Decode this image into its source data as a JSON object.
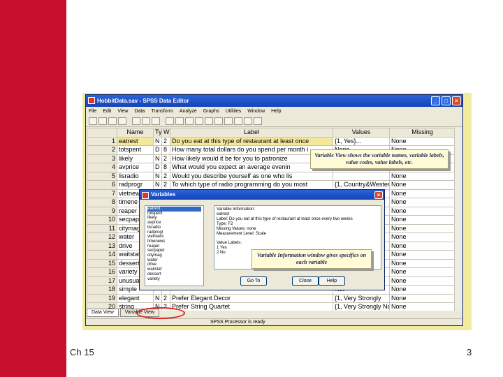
{
  "slide": {
    "footer_left": "Ch 15",
    "page_number": "3",
    "accent_color": "#c8102e"
  },
  "window": {
    "title": "HobbitData.sav - SPSS Data Editor",
    "controls": [
      "_",
      "□",
      "×"
    ],
    "menu": [
      "File",
      "Edit",
      "View",
      "Data",
      "Transform",
      "Analyze",
      "Graphs",
      "Utilities",
      "Window",
      "Help"
    ],
    "columns": [
      "",
      "Name",
      "Ty",
      "W",
      "Label",
      "Values",
      "Missing"
    ],
    "rows": [
      {
        "n": "1",
        "name": "eatrest",
        "t": "N",
        "w": "2",
        "label": "Do you eat at this type of restaurant at least once",
        "values": "{1, Yes}...",
        "missing": "None"
      },
      {
        "n": "2",
        "name": "totspent",
        "t": "D",
        "w": "8",
        "label": "How many total dollars do you spend per month i",
        "values": "None",
        "missing": "None"
      },
      {
        "n": "3",
        "name": "likely",
        "t": "N",
        "w": "2",
        "label": "How likely would it be for you to patronize",
        "values": "",
        "missing": "None"
      },
      {
        "n": "4",
        "name": "avprice",
        "t": "D",
        "w": "8",
        "label": "What would you expect an average evenin",
        "values": "",
        "missing": "None"
      },
      {
        "n": "5",
        "name": "lisradio",
        "t": "N",
        "w": "2",
        "label": "Would you describe yourself as one who lis",
        "values": "",
        "missing": "None"
      },
      {
        "n": "6",
        "name": "radprogr",
        "t": "N",
        "w": "2",
        "label": "To which type of radio programming do you most",
        "values": "{1, Country&Western}...",
        "missing": "None"
      },
      {
        "n": "7",
        "name": "vietnews",
        "t": "",
        "w": "",
        "label": "",
        "values": "",
        "missing": "None"
      },
      {
        "n": "8",
        "name": "timene",
        "t": "",
        "w": "",
        "label": "",
        "values": "s}...",
        "missing": "None"
      },
      {
        "n": "9",
        "name": "reaper",
        "t": "",
        "w": "",
        "label": "",
        "values": "",
        "missing": "None"
      },
      {
        "n": "10",
        "name": "secpap",
        "t": "",
        "w": "",
        "label": "",
        "values": "",
        "missing": "None"
      },
      {
        "n": "11",
        "name": "citymag",
        "t": "",
        "w": "",
        "label": "",
        "values": "",
        "missing": "None"
      },
      {
        "n": "12",
        "name": "water",
        "t": "",
        "w": "",
        "label": "",
        "values": "Not",
        "missing": "None"
      },
      {
        "n": "13",
        "name": "drive",
        "t": "",
        "w": "",
        "label": "",
        "values": "Not",
        "missing": "None"
      },
      {
        "n": "14",
        "name": "waitstaf",
        "t": "",
        "w": "",
        "label": "",
        "values": "Not",
        "missing": "None"
      },
      {
        "n": "15",
        "name": "dessert",
        "t": "",
        "w": "",
        "label": "",
        "values": "Not",
        "missing": "None"
      },
      {
        "n": "16",
        "name": "variety",
        "t": "",
        "w": "",
        "label": "",
        "values": "Not",
        "missing": "None"
      },
      {
        "n": "17",
        "name": "unusual",
        "t": "",
        "w": "",
        "label": "",
        "values": "Not",
        "missing": "None"
      },
      {
        "n": "18",
        "name": "simple",
        "t": "",
        "w": "",
        "label": "",
        "values": "Not",
        "missing": "None"
      },
      {
        "n": "19",
        "name": "elegant",
        "t": "N",
        "w": "2",
        "label": "Prefer Elegant Decor",
        "values": "{1, Very Strongly",
        "missing": "None"
      },
      {
        "n": "20",
        "name": "string",
        "t": "N",
        "w": "2",
        "label": "Prefer String Quartet",
        "values": "{1, Very Strongly Not",
        "missing": "None"
      }
    ],
    "tabs": [
      "Data View",
      "Variable View"
    ],
    "status": "SPSS Processor is ready"
  },
  "callouts": {
    "variable_view": "Variable View shows the variable names, variable labels, value codes, value labels, etc.",
    "info_window": "Variable Information window gives specifics on each variable"
  },
  "dialog": {
    "title": "Variables",
    "variables": [
      "eatrest",
      "totspent",
      "likely",
      "avprice",
      "lisradio",
      "radprogr",
      "vietnews",
      "timenews",
      "reaper",
      "secpaper",
      "citymag",
      "water",
      "drive",
      "waitstaf",
      "dessert",
      "variety"
    ],
    "selected_index": 0,
    "info_heading": "Variable Information:",
    "info_lines": [
      "eatrest",
      "Label: Do you eat at this type of restaurant at least once every two weeks",
      "Type: F2",
      "Missing Values: none",
      "Measurement Level: Scale",
      "",
      "Value Labels:",
      "1 Yes",
      "2 No"
    ],
    "buttons": [
      "Go To",
      "Close",
      "Help"
    ]
  }
}
